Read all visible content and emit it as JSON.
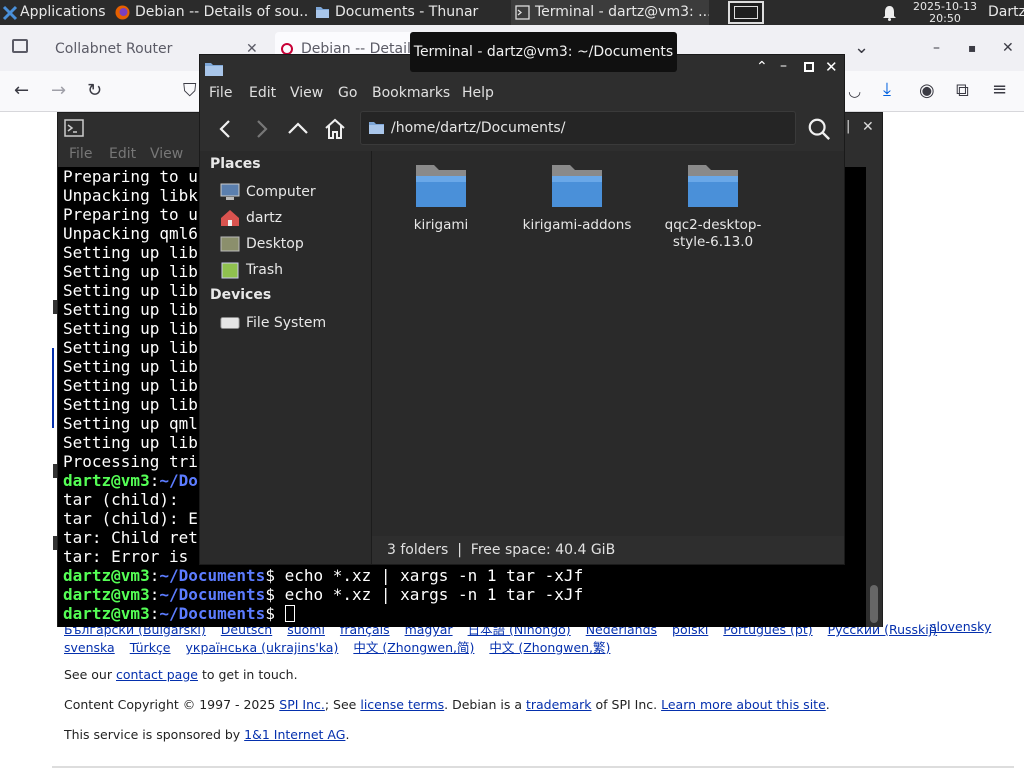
{
  "panel": {
    "applications_label": "Applications",
    "tasks": [
      {
        "label": "Debian -- Details of sou...",
        "icon": "firefox-icon"
      },
      {
        "label": "Documents - Thunar",
        "icon": "folder-icon"
      },
      {
        "label": "Terminal - dartz@vm3: ...",
        "icon": "terminal-icon"
      }
    ],
    "clock_date": "2025-10-13",
    "clock_time": "20:50",
    "user": "Dartz"
  },
  "browser": {
    "tabs": [
      "Collabnet Router",
      "Debian -- Details"
    ],
    "page": {
      "languages_line1": [
        "Български (Bulgarski)",
        "Deutsch",
        "suomi",
        "français",
        "magyar",
        "日本語 (Nihongo)",
        "Nederlands",
        "polski",
        "Português (pt)",
        "Русский (Russkij)",
        "slovensky"
      ],
      "languages_line2": [
        "svenska",
        "Türkçe",
        "українська (ukrajins'ka)",
        "中文 (Zhongwen,简)",
        "中文 (Zhongwen,繁)"
      ],
      "contact": {
        "pre": "See our ",
        "link": "contact page",
        "post": " to get in touch."
      },
      "copyright": {
        "t1": "Content Copyright © 1997 - 2025 ",
        "l1": "SPI Inc.",
        "t2": "; See ",
        "l2": "license terms",
        "t3": ". Debian is a ",
        "l3": "trademark",
        "t4": " of SPI Inc. ",
        "l4": "Learn more about this site",
        "t5": "."
      },
      "sponsor": {
        "pre": "This service is sponsored by ",
        "link": "1&1 Internet AG",
        "post": "."
      }
    }
  },
  "terminal": {
    "menu": [
      "File",
      "Edit",
      "View"
    ],
    "lines": [
      "Preparing to u",
      "Unpacking libk",
      "Preparing to u",
      "Unpacking qml6",
      "Setting up lib",
      "Setting up lib",
      "Setting up lib",
      "Setting up lib",
      "Setting up lib",
      "Setting up lib",
      "Setting up lib",
      "Setting up lib",
      "Setting up lib",
      "Setting up qml",
      "Setting up lib",
      "Processing tri"
    ],
    "prompt_user": "dartz@vm3",
    "prompt_path_short": "~/Do",
    "prompt_path": "~/Documents",
    "error_lines": [
      "tar (child): ",
      "tar (child): E",
      "tar: Child ret",
      "tar: Error is "
    ],
    "command": "echo *.xz | xargs -n 1 tar -xJf",
    "tooltip": "Terminal - dartz@vm3: ~/Documents"
  },
  "thunar": {
    "title": "Documents - Thunar",
    "menu": [
      "File",
      "Edit",
      "View",
      "Go",
      "Bookmarks",
      "Help"
    ],
    "path": "/home/dartz/Documents/",
    "places_heading": "Places",
    "places": [
      "Computer",
      "dartz",
      "Desktop",
      "Trash"
    ],
    "devices_heading": "Devices",
    "devices": [
      "File System"
    ],
    "folders": [
      "kirigami",
      "kirigami-addons",
      "qqc2-desktop-style-6.13.0"
    ],
    "status": "3 folders  |  Free space: 40.4 GiB"
  }
}
